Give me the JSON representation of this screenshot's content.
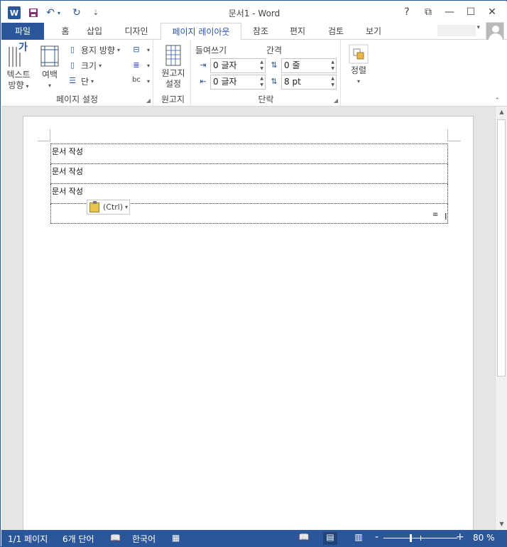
{
  "window": {
    "title": "문서1 - Word",
    "help": "?",
    "minimize": "—",
    "maximize": "☐",
    "close": "✕",
    "ribbon_display": "⧉"
  },
  "qat": {
    "logo": "W",
    "save": "💾",
    "undo": "↶",
    "redo": "↻",
    "more": "▾",
    "undo_dd": "▾",
    "custom": "⇣"
  },
  "tabs": [
    {
      "label": "파일"
    },
    {
      "label": "홈"
    },
    {
      "label": "삽입"
    },
    {
      "label": "디자인"
    },
    {
      "label": "페이지 레이아웃"
    },
    {
      "label": "참조"
    },
    {
      "label": "편지"
    },
    {
      "label": "검토"
    },
    {
      "label": "보기"
    }
  ],
  "ribbon": {
    "text_direction_line1": "텍스트",
    "text_direction_line2": "방향",
    "margins_label": "여백",
    "orientation": "용지 방향",
    "size": "크기",
    "columns": "단",
    "page_setup_group": "페이지 설정",
    "manuscript_line1": "원고지",
    "manuscript_line2": "설정",
    "manuscript_group": "원고지",
    "indent_header": "들여쓰기",
    "spacing_header": "간격",
    "indent_left": "0 글자",
    "indent_right": "0 글자",
    "spacing_before": "0 줄",
    "spacing_after": "8 pt",
    "paragraph_group": "단락",
    "arrange": "정렬",
    "text_icon": "가"
  },
  "document": {
    "rows": [
      "문서 작성",
      "문서 작성",
      "문서 작성",
      ""
    ],
    "paste_label": "(Ctrl)"
  },
  "status": {
    "page": "1/1 페이지",
    "words": "6개 단어",
    "language": "한국어",
    "zoom": "80 %",
    "zoom_minus": "-",
    "zoom_plus": "+"
  }
}
